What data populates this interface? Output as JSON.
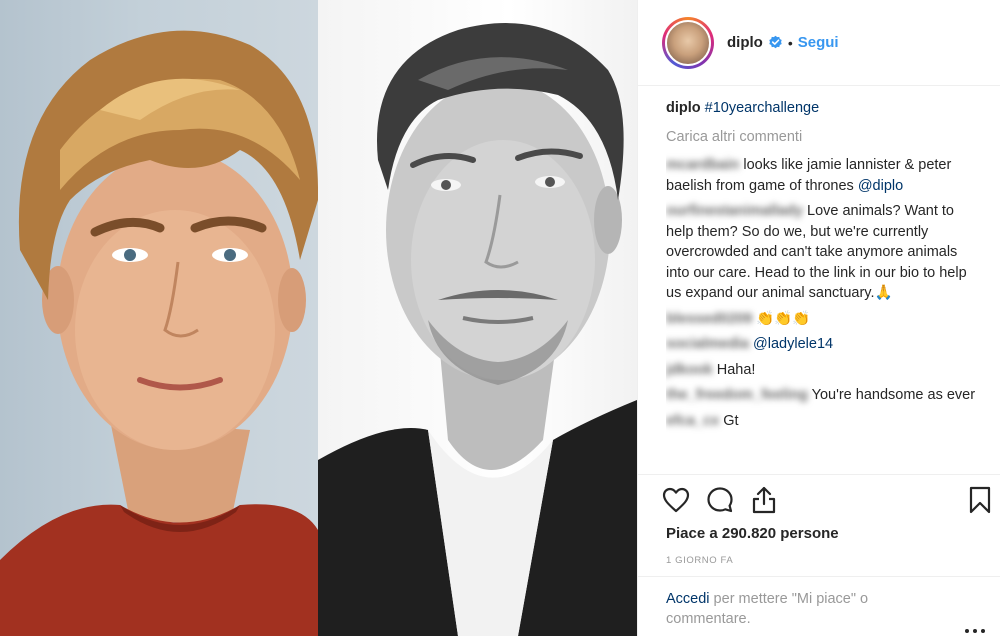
{
  "header": {
    "username": "diplo",
    "verified_icon": "verified-badge-icon",
    "separator": "•",
    "follow_label": "Segui"
  },
  "caption": {
    "user": "diplo",
    "hashtag": "#10yearchallenge"
  },
  "load_more_label": "Carica altri commenti",
  "comments": [
    {
      "user": "mcardbain",
      "text": "looks like jamie lannister & peter baelish from game of thrones ",
      "mention": "@diplo"
    },
    {
      "user": "ourfinestanimallady",
      "text": "Love animals? Want to help them? So do we, but we're currently overcrowded and can't take anymore animals into our care. Head to the link in our bio to help us expand our animal sanctuary.",
      "emoji": "🙏"
    },
    {
      "user": "blessed0209",
      "text": "",
      "emoji": "👏👏👏"
    },
    {
      "user": "socialmedia",
      "text": "",
      "mention": "@ladylele14"
    },
    {
      "user": "jdkook",
      "text": "Haha!"
    },
    {
      "user": "the_freedom_feeling",
      "text": "You're handsome as ever"
    },
    {
      "user": "efca_cx",
      "text": "Gt"
    }
  ],
  "actions": {
    "like_icon": "heart-icon",
    "comment_icon": "comment-icon",
    "share_icon": "share-icon",
    "save_icon": "bookmark-icon"
  },
  "likes_text": "Piace a 290.820 persone",
  "date_text": "1 GIORNO FA",
  "footer": {
    "login_link": "Accedi",
    "login_rest": " per mettere \"Mi piace\" o commentare.",
    "more_icon": "more-options-icon"
  },
  "colors": {
    "link_blue": "#3897f0",
    "dark_link": "#003569",
    "muted_gray": "#999999",
    "text": "#262626"
  }
}
